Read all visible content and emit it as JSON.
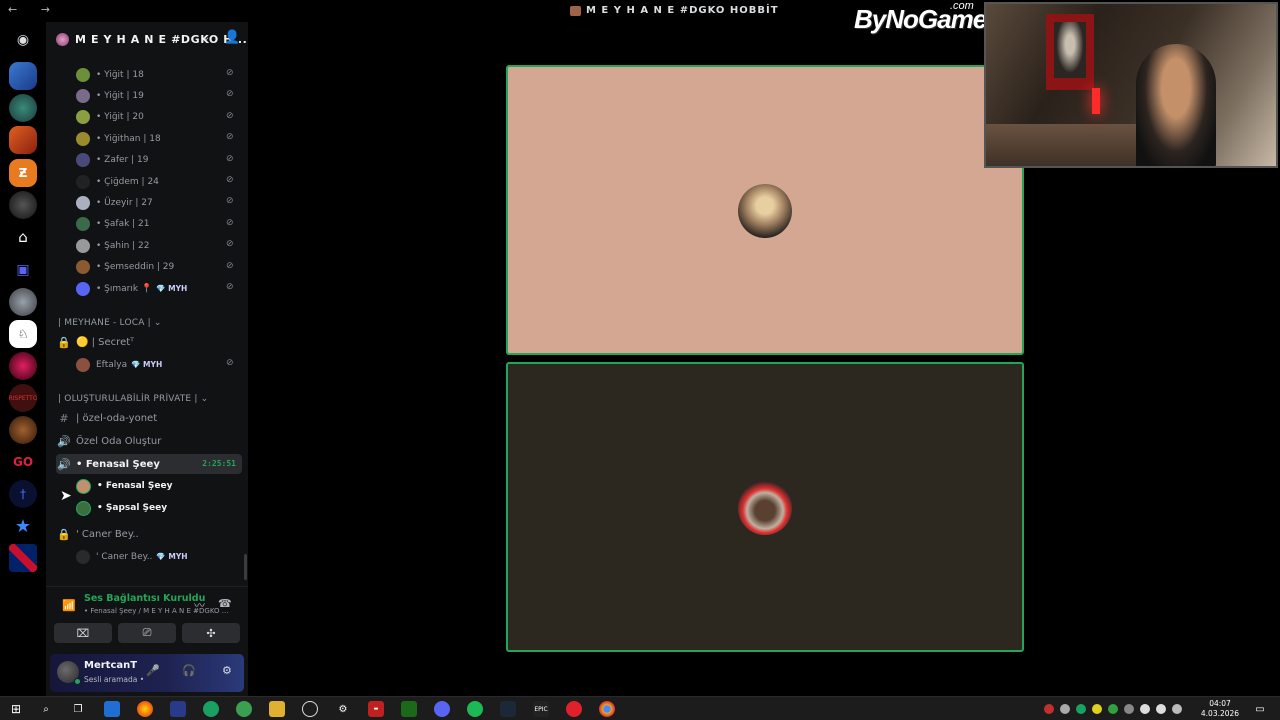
{
  "window": {
    "title": "M E Y H A N E #DGKO HOBBİT",
    "nav": "←  →"
  },
  "server": {
    "name": "M E Y H A N E #DGKO H...",
    "chevron": "⌄",
    "invite_icon": "person-add-icon"
  },
  "members_top": [
    {
      "name": "• Yiğit | 18",
      "color": "#6b8f3a"
    },
    {
      "name": "• Yiğit | 19",
      "color": "#7a6b8a"
    },
    {
      "name": "• Yiğit | 20",
      "color": "#8aa040"
    },
    {
      "name": "• Yiğithan | 18",
      "color": "#9a8a30"
    },
    {
      "name": "• Zafer | 19",
      "color": "#4a4a7a"
    },
    {
      "name": "• Çiğdem | 24",
      "color": "#222222"
    },
    {
      "name": "• Üzeyir | 27",
      "color": "#aab0c0"
    },
    {
      "name": "• Şafak | 21",
      "color": "#3a6a4a"
    },
    {
      "name": "• Şahin | 22",
      "color": "#999999"
    },
    {
      "name": "• Şemseddin | 29",
      "color": "#8a5a30"
    },
    {
      "name": "• Şımarık 📍",
      "color": "#5865f2",
      "badge": "💎 MYH"
    }
  ],
  "category_loca": "| MEYHANE - LOCA |  ⌄",
  "channel_secret": "🟡 | Secretᵀ",
  "member_eftalya": {
    "name": "Eftalya",
    "badge": "💎 MYH",
    "color": "#8a5040"
  },
  "category_private": "| OLUŞTURULABİLİR PRİVATE |  ⌄",
  "channel_ozel_oda_yonet": "| özel-oda-yonet",
  "channel_ozel_oda_olustur": "Özel Oda Oluştur",
  "channel_active": {
    "name": "• Fenasal Şeey",
    "timer": "2:25:51"
  },
  "voice_users": [
    {
      "name": "• Fenasal Şeey",
      "color": "#c09070"
    },
    {
      "name": "• Şapsal Şeey",
      "color": "#3a7040"
    }
  ],
  "channel_caner": "' Caner Bey..",
  "member_caner": {
    "name": "' Caner Bey..",
    "badge": "💎 MYH",
    "color": "#2a2a2a"
  },
  "voice": {
    "connected": "Ses Bağlantısı Kuruldu",
    "subtitle": "• Fenasal Şeey / M E Y H A N E #DGKO ..."
  },
  "user": {
    "name": "MertcanT",
    "status": "Sesli aramada •"
  },
  "overlay": {
    "brand": "ByNoGame",
    "brand_suffix": ".com"
  },
  "colors": {
    "tile_top": "#d4a793",
    "tile_bottom": "#2c2820",
    "speaking_border": "#23a55a",
    "accent_green": "#23a55a"
  },
  "taskbar": {
    "time": "04:07",
    "date": "4.03.2026"
  }
}
